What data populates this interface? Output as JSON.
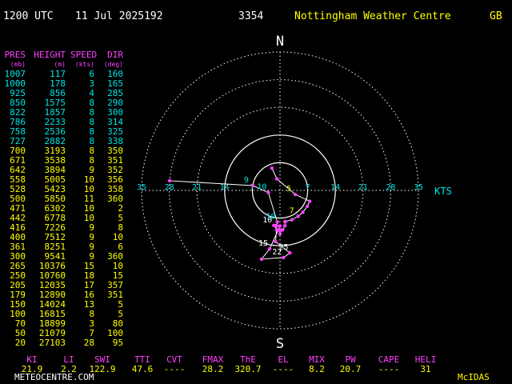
{
  "header": {
    "time": "1200 UTC",
    "date": "11 Jul 2025192",
    "station_id": "3354",
    "station_name": "Nottingham Weather Centre",
    "country": "GB"
  },
  "table": {
    "headers": [
      "PRES",
      "HEIGHT",
      "SPEED",
      "DIR"
    ],
    "units": [
      "(mb)",
      "(m)",
      "(kts)",
      "(deg)"
    ],
    "rows": [
      [
        "1007",
        "117",
        "6",
        "160"
      ],
      [
        "1000",
        "178",
        "3",
        "165"
      ],
      [
        "925",
        "856",
        "4",
        "285"
      ],
      [
        "850",
        "1575",
        "8",
        "290"
      ],
      [
        "822",
        "1857",
        "8",
        "300"
      ],
      [
        "786",
        "2233",
        "8",
        "314"
      ],
      [
        "758",
        "2536",
        "8",
        "325"
      ],
      [
        "727",
        "2882",
        "8",
        "338"
      ],
      [
        "700",
        "3193",
        "8",
        "350"
      ],
      [
        "671",
        "3538",
        "8",
        "351"
      ],
      [
        "642",
        "3894",
        "9",
        "352"
      ],
      [
        "558",
        "5005",
        "10",
        "356"
      ],
      [
        "528",
        "5423",
        "10",
        "358"
      ],
      [
        "500",
        "5850",
        "11",
        "360"
      ],
      [
        "471",
        "6302",
        "10",
        "2"
      ],
      [
        "442",
        "6778",
        "10",
        "5"
      ],
      [
        "416",
        "7226",
        "9",
        "8"
      ],
      [
        "400",
        "7512",
        "9",
        "10"
      ],
      [
        "361",
        "8251",
        "9",
        "6"
      ],
      [
        "300",
        "9541",
        "9",
        "360"
      ],
      [
        "265",
        "10376",
        "15",
        "10"
      ],
      [
        "250",
        "10760",
        "18",
        "15"
      ],
      [
        "205",
        "12035",
        "17",
        "357"
      ],
      [
        "179",
        "12890",
        "16",
        "351"
      ],
      [
        "150",
        "14024",
        "13",
        "5"
      ],
      [
        "100",
        "16815",
        "8",
        "5"
      ],
      [
        "70",
        "18899",
        "3",
        "80"
      ],
      [
        "50",
        "21079",
        "7",
        "100"
      ],
      [
        "20",
        "27103",
        "28",
        "95"
      ]
    ]
  },
  "indices": {
    "labels": [
      "KI",
      "LI",
      "SWI",
      "TTI",
      "CVT",
      "FMAX",
      "ThE",
      "EL",
      "MIX",
      "PW",
      "CAPE",
      "HELI"
    ],
    "values": [
      "21.9",
      "2.2",
      "122.9",
      "47.6",
      "----",
      "28.2",
      "320.7",
      "----",
      "8.2",
      "20.7",
      "----",
      "31"
    ]
  },
  "footer": {
    "left": "METEOCENTRE.COM",
    "right": "McIDAS"
  },
  "chart_data": {
    "type": "hodograph",
    "compass": {
      "north": "N",
      "south": "S"
    },
    "speed_unit": "KTS",
    "ring_interval_kts": 7,
    "max_kts": 35,
    "west_tick_labels": [
      "35",
      "28",
      "21",
      "14",
      "7"
    ],
    "east_tick_labels": [
      "7",
      "14",
      "21",
      "28",
      "35"
    ],
    "colors": {
      "rings": "#ffffff",
      "trace": "#ffffff",
      "markers": "#ff40ff"
    },
    "wind_profile_dir_deg": [
      160,
      165,
      285,
      290,
      300,
      314,
      325,
      338,
      350,
      351,
      352,
      356,
      358,
      360,
      2,
      5,
      8,
      10,
      6,
      360,
      10,
      15,
      357,
      351,
      5,
      5,
      80,
      100,
      95
    ],
    "wind_profile_speed_kts": [
      6,
      3,
      4,
      8,
      8,
      8,
      8,
      8,
      8,
      8,
      9,
      10,
      10,
      11,
      10,
      10,
      9,
      9,
      9,
      9,
      15,
      18,
      17,
      16,
      13,
      8,
      3,
      7,
      28
    ],
    "point_labels": [
      {
        "idx": 2,
        "text": "5",
        "color": "#ffff00"
      },
      {
        "idx": 6,
        "text": "7",
        "color": "#ffff00"
      },
      {
        "idx": 17,
        "text": "10",
        "color": "#ffffff"
      },
      {
        "idx": 20,
        "text": "15",
        "color": "#ffffff"
      },
      {
        "idx": 23,
        "text": "25",
        "color": "#ffffff"
      },
      {
        "idx": 22,
        "text": "22",
        "color": "#ffffff"
      },
      {
        "idx": 26,
        "text": "10",
        "color": "#00e5e5"
      },
      {
        "idx": 25,
        "text": "10",
        "color": "#00e5e5"
      },
      {
        "idx": 27,
        "text": "9",
        "color": "#00e5e5"
      }
    ]
  }
}
